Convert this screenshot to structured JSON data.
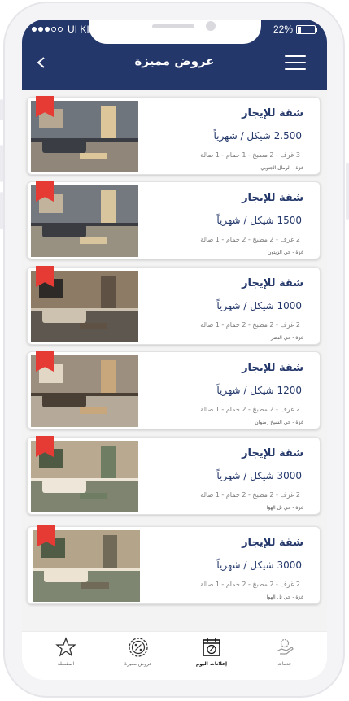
{
  "status": {
    "carrier": "UI KIT",
    "battery": "22%",
    "battery_level": 0.22
  },
  "header": {
    "title": "عروض مميزة",
    "back_icon": "back-arrow-icon",
    "menu_icon": "hamburger-menu-icon"
  },
  "listings": [
    {
      "title": "شقة للإيجار",
      "price": "2.500 شيكل / شهرياً",
      "specs": "3 غرف - 2 مطبخ - 1 حمام - 1 صالة",
      "location": "غزة - الرمال الجنوبي"
    },
    {
      "title": "شقة للإيجار",
      "price": "1500 شيكل / شهرياً",
      "specs": "2 غرف - 2 مطبخ - 2 حمام - 1 صالة",
      "location": "غزة - حي الزيتون"
    },
    {
      "title": "شقة للإيجار",
      "price": "1000 شيكل / شهرياً",
      "specs": "2 غرف - 2 مطبخ - 2 حمام - 1 صالة",
      "location": "غزة - حي النصر"
    },
    {
      "title": "شقة للإيجار",
      "price": "1200 شيكل / شهرياً",
      "specs": "2 غرف - 2 مطبخ - 2 حمام - 1 صالة",
      "location": "غزة - حي الشيخ رضوان"
    },
    {
      "title": "شقة للإيجار",
      "price": "3000 شيكل / شهرياً",
      "specs": "2 غرف - 2 مطبخ - 2 حمام - 1 صالة",
      "location": "غزة - حي تل الهوا"
    },
    {
      "title": "شقة للإيجار",
      "price": "3000 شيكل / شهرياً",
      "specs": "2 غرف - 2 مطبخ - 2 حمام - 1 صالة",
      "location": "غزة - حي تل الهوا"
    }
  ],
  "tabs": [
    {
      "label": "المفضلة",
      "icon": "star-icon",
      "active": false
    },
    {
      "label": "عروض مميزة",
      "icon": "discount-badge-icon",
      "active": false
    },
    {
      "label": "إعلانات اليوم",
      "icon": "calendar-percent-icon",
      "active": true
    },
    {
      "label": "خدمات",
      "icon": "services-hand-icon",
      "active": false
    }
  ],
  "colors": {
    "primary": "#23376a",
    "bookmark": "#e63a35",
    "background": "#f3f3f3"
  }
}
